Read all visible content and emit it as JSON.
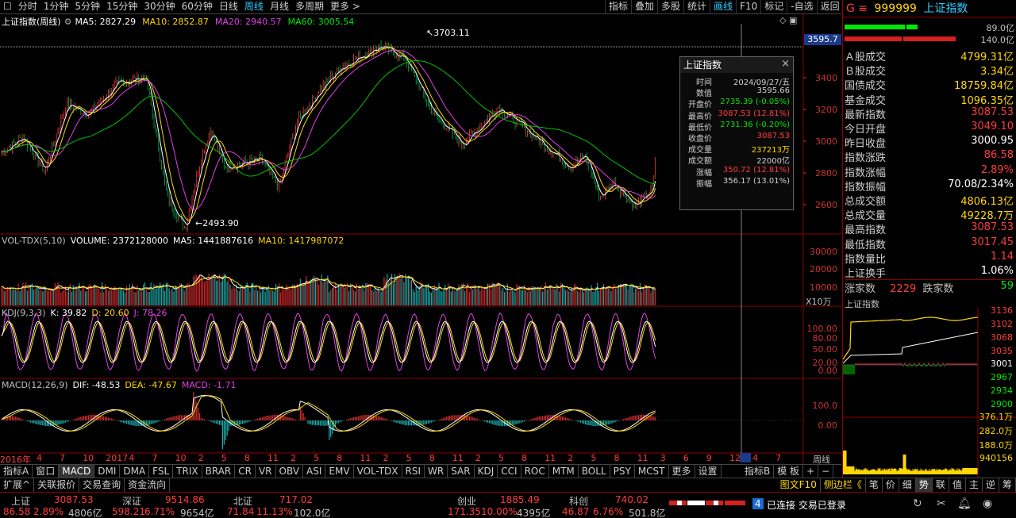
{
  "topbar": {
    "timeframes": [
      "分时",
      "1分钟",
      "5分钟",
      "15分钟",
      "30分钟",
      "60分钟",
      "日线",
      "周线",
      "月线",
      "多周期",
      "更多 >"
    ],
    "active": "周线",
    "right_buttons": [
      "指标",
      "叠加",
      "多股",
      "统计",
      "画线",
      "F10",
      "标记",
      "-自选",
      "返回"
    ],
    "right_active": "画线"
  },
  "main": {
    "title": "上证指数(周线)",
    "ma": [
      {
        "label": "MA5: 2827.29",
        "color": "#ffffff"
      },
      {
        "label": "MA10: 2852.87",
        "color": "#ffd700"
      },
      {
        "label": "MA20: 2940.57",
        "color": "#e040e0"
      },
      {
        "label": "MA60: 3005.54",
        "color": "#00e600"
      }
    ],
    "high_label": "3703.11",
    "low_label": "2493.90",
    "price_tag": "3595.7",
    "yaxis": [
      "3400",
      "3200",
      "3000",
      "2800",
      "2600"
    ]
  },
  "popup": {
    "title": "上证指数",
    "close": "×",
    "rows": [
      {
        "k": "时间",
        "v": "2024/09/27/五",
        "c": "#d0d0d0"
      },
      {
        "k": "数值",
        "v": "3595.66",
        "c": "#d0d0d0"
      },
      {
        "k": "开盘价",
        "v": "2735.39 (-0.05%)",
        "c": "#00e600"
      },
      {
        "k": "最高价",
        "v": "3087.53 (12.81%)",
        "c": "#ff3c3c"
      },
      {
        "k": "最低价",
        "v": "2731.36 (-0.20%)",
        "c": "#00e600"
      },
      {
        "k": "收盘价",
        "v": "3087.53",
        "c": "#ff3c3c"
      },
      {
        "k": "成交量",
        "v": "237213万",
        "c": "#ffd700"
      },
      {
        "k": "成交额",
        "v": "22000亿",
        "c": "#d0d0d0"
      },
      {
        "k": "涨幅",
        "v": "350.72 (12.81%)",
        "c": "#ff3c3c"
      },
      {
        "k": "振幅",
        "v": "356.17 (13.01%)",
        "c": "#d0d0d0"
      }
    ]
  },
  "vol": {
    "title": "VOL-TDX(5,10)",
    "volume": "VOLUME: 2372128000",
    "ma5": "MA5: 1441887616",
    "ma10": "MA10: 1417987072",
    "yaxis": [
      "30000",
      "20000",
      "10000"
    ],
    "unit": "X10万"
  },
  "kdj": {
    "title": "KDJ(9,3,3)",
    "k": "K: 39.82",
    "d": "D: 20.60",
    "j": "J: 78.26",
    "yaxis": [
      "100.00",
      "80.00",
      "50.00",
      "20.00",
      "0.00"
    ]
  },
  "macd": {
    "title": "MACD(12,26,9)",
    "dif": "DIF: -48.53",
    "dea": "DEA: -47.67",
    "macd": "MACD: -1.71",
    "yaxis": [
      "100.0",
      "0.00"
    ]
  },
  "xaxis": {
    "labels": [
      "2016年",
      "4",
      "7",
      "10",
      "2017",
      "4",
      "7",
      "10",
      "2",
      "5",
      "8",
      "11",
      "2",
      "5",
      "8",
      "11",
      "2",
      "5",
      "8",
      "11",
      "2",
      "5",
      "8",
      "11",
      "2",
      "5",
      "8",
      "11",
      "3",
      "6",
      "9",
      "12",
      "4",
      "7"
    ],
    "right_label": "周线"
  },
  "tabs": [
    "指标A",
    "窗口",
    "MACD",
    "DMI",
    "DMA",
    "FSL",
    "TRIX",
    "BRAR",
    "CR",
    "VR",
    "OBV",
    "ASI",
    "EMV",
    "VOL-TDX",
    "RSI",
    "WR",
    "SAR",
    "KDJ",
    "CCI",
    "ROC",
    "MTM",
    "BOLL",
    "PSY",
    "MCST",
    "更多",
    "设置"
  ],
  "tabs_active": "MACD",
  "tabs_right": [
    "指标B",
    "模 板",
    "+",
    "−"
  ],
  "row2": [
    "扩展^",
    "关联报价",
    "交易查询",
    "资金流向"
  ],
  "row2_right": [
    "图文F10",
    "侧边栏《",
    "笔",
    "价",
    "细",
    "势",
    "联",
    "值",
    "主",
    "逆",
    "筹"
  ],
  "right_panel": {
    "title_prefix": "G ≡",
    "code": "999999",
    "name": "上证指数",
    "bar_vals": [
      "89.0亿",
      "140.0亿"
    ],
    "rows": [
      {
        "l": "Ａ股成交",
        "v": "4799.31亿",
        "c": "#ffd700"
      },
      {
        "l": "Ｂ股成交",
        "v": "3.34亿",
        "c": "#ffd700"
      },
      {
        "l": "国债成交",
        "v": "18759.84亿",
        "c": "#ffd700"
      },
      {
        "l": "基金成交",
        "v": "1096.35亿",
        "c": "#ffd700"
      },
      {
        "l": "最新指数",
        "v": "3087.53",
        "c": "#ff3c3c"
      },
      {
        "l": "今日开盘",
        "v": "3049.10",
        "c": "#ff3c3c"
      },
      {
        "l": "昨日收盘",
        "v": "3000.95",
        "c": "#ffffff"
      },
      {
        "l": "指数涨跌",
        "v": "86.58",
        "c": "#ff3c3c"
      },
      {
        "l": "指数涨幅",
        "v": "2.89%",
        "c": "#ff3c3c"
      },
      {
        "l": "指数振幅",
        "v": "70.08/2.34%",
        "c": "#ffffff"
      },
      {
        "l": "总成交额",
        "v": "4806.13亿",
        "c": "#ffd700"
      },
      {
        "l": "总成交量",
        "v": "49228.7万",
        "c": "#ffd700"
      },
      {
        "l": "最高指数",
        "v": "3087.53",
        "c": "#ff3c3c"
      },
      {
        "l": "最低指数",
        "v": "3017.45",
        "c": "#ff3c3c"
      },
      {
        "l": "指数量比",
        "v": "1.14",
        "c": "#ff3c3c"
      },
      {
        "l": "上证换手",
        "v": "1.06%",
        "c": "#ffffff"
      }
    ],
    "rise_label": "涨家数",
    "rise_val": "2229",
    "fall_label": "跌家数",
    "fall_val": "59",
    "mini_title": "上证指数",
    "mini_yaxis": [
      "3136",
      "3102",
      "3068",
      "3035",
      "3001",
      "2967",
      "2934",
      "2900"
    ],
    "mini_vol_axis": [
      "376.1万",
      "282.0万",
      "188.0万",
      "940156"
    ]
  },
  "status": {
    "sh": {
      "name": "上证",
      "val": "3087.53",
      "chg": "86.58",
      "pct": "2.89%",
      "amt": "4806亿"
    },
    "sz": {
      "name": "深证",
      "val": "9514.86",
      "chg": "598.21",
      "pct": "6.71%",
      "amt": "9654亿"
    },
    "bz": {
      "name": "北证",
      "val": "717.02",
      "chg": "71.84",
      "pct": "11.13%",
      "amt": "102.0亿"
    },
    "cy": {
      "name": "创业",
      "val": "1885.49",
      "chg": "171.35",
      "pct": "10.00%",
      "amt": "4395亿"
    },
    "kc": {
      "name": "科创",
      "val": "740.02",
      "chg": "46.87",
      "pct": "6.76%",
      "amt": "501.8亿"
    },
    "conn_num": "4",
    "conn": "已连接 交易已登录"
  }
}
